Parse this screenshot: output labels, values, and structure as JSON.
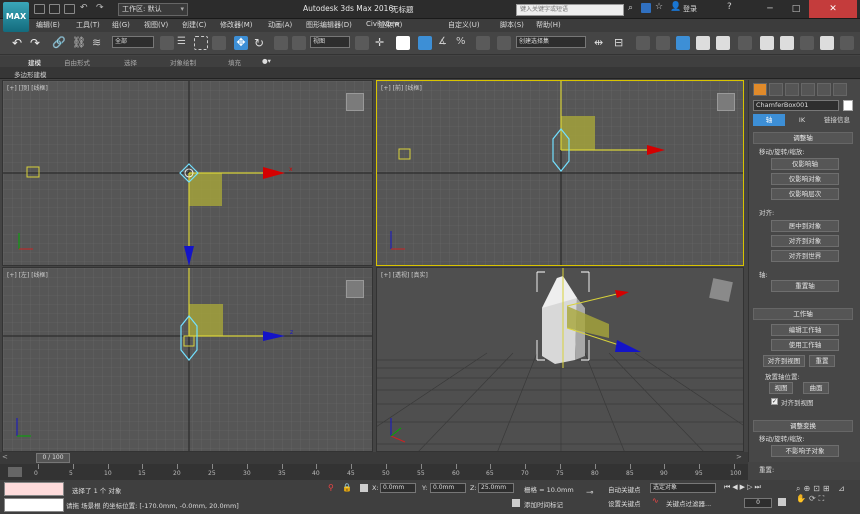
{
  "app_title": "Autodesk 3ds Max 2016",
  "doc_title": "无标题",
  "workspace": "工作区: 默认",
  "search_placeholder": "键入关键字或短语",
  "login": "登录",
  "menus": [
    "编辑(E)",
    "工具(T)",
    "组(G)",
    "视图(V)",
    "创建(C)",
    "修改器(M)",
    "动画(A)",
    "图形编辑器(D)",
    "渲染(R)",
    "Civil View",
    "自定义(U)",
    "脚本(S)",
    "帮助(H)"
  ],
  "toolbar": {
    "selection_filter": "全部",
    "ref_coord": "视图",
    "named_selection": "创建选择集"
  },
  "ribbon_tabs": [
    "建模",
    "自由形式",
    "选择",
    "对象绘制",
    "填充"
  ],
  "ribbon_sub": "多边形建模",
  "viewports": {
    "top": "[+] [顶] [线框]",
    "front": "[+] [前] [线框]",
    "left": "[+] [左] [线框]",
    "persp": "[+] [透视] [真实]"
  },
  "command_panel": {
    "object_name": "ChamferBox001",
    "tabs": [
      "轴",
      "IK",
      "链接信息"
    ],
    "rollout_adjust_pivot": "调整轴",
    "move_rotate_scale": "移动/旋转/缩放:",
    "btn_affect_pivot": "仅影响轴",
    "btn_affect_object": "仅影响对象",
    "btn_affect_hierarchy": "仅影响层次",
    "align_label": "对齐:",
    "btn_center_to_object": "居中到对象",
    "btn_align_to_object": "对齐到对象",
    "btn_align_to_world": "对齐到世界",
    "pivot_label": "轴:",
    "btn_reset_pivot": "重置轴",
    "rollout_working_pivot": "工作轴",
    "btn_edit_working_pivot": "编辑工作轴",
    "btn_use_working_pivot": "使用工作轴",
    "btn_align_to_view": "对齐到视图",
    "btn_reset": "重置",
    "place_pivot_label": "放置轴位置:",
    "btn_view": "视图",
    "btn_surface": "曲面",
    "chk_align_to_view": "对齐到视图",
    "rollout_adjust_transform": "调整变换",
    "move_rotate_scale2": "移动/旋转/缩放:",
    "btn_dont_affect_children": "不影响子对象",
    "reset_label": "重置:"
  },
  "timeline": {
    "frame": "0 / 100",
    "ticks": [
      "0",
      "5",
      "10",
      "15",
      "20",
      "25",
      "30",
      "35",
      "40",
      "45",
      "50",
      "55",
      "60",
      "65",
      "70",
      "75",
      "80",
      "85",
      "90",
      "95",
      "100"
    ]
  },
  "status": {
    "selection_msg": "选择了 1 个 对象",
    "prompt_msg": "请拖 场景根 的坐标位置: [-170.0mm, -0.0mm, 20.0mm]",
    "x_label": "X:",
    "x_val": "0.0mm",
    "y_label": "Y:",
    "y_val": "0.0mm",
    "z_label": "Z:",
    "z_val": "25.0mm",
    "grid": "栅格 = 10.0mm",
    "add_time_tag": "添加时间标记",
    "auto_key": "自动关键点",
    "set_key": "设置关键点",
    "selected_dropdown": "选定对象",
    "key_filters": "关键点过滤器...",
    "frame_field": "0"
  },
  "colors": {
    "accent": "#3d8fd6",
    "yellow": "#d8d23a",
    "cyan": "#72e0ff",
    "red": "#d40000",
    "blue": "#1414c8"
  }
}
